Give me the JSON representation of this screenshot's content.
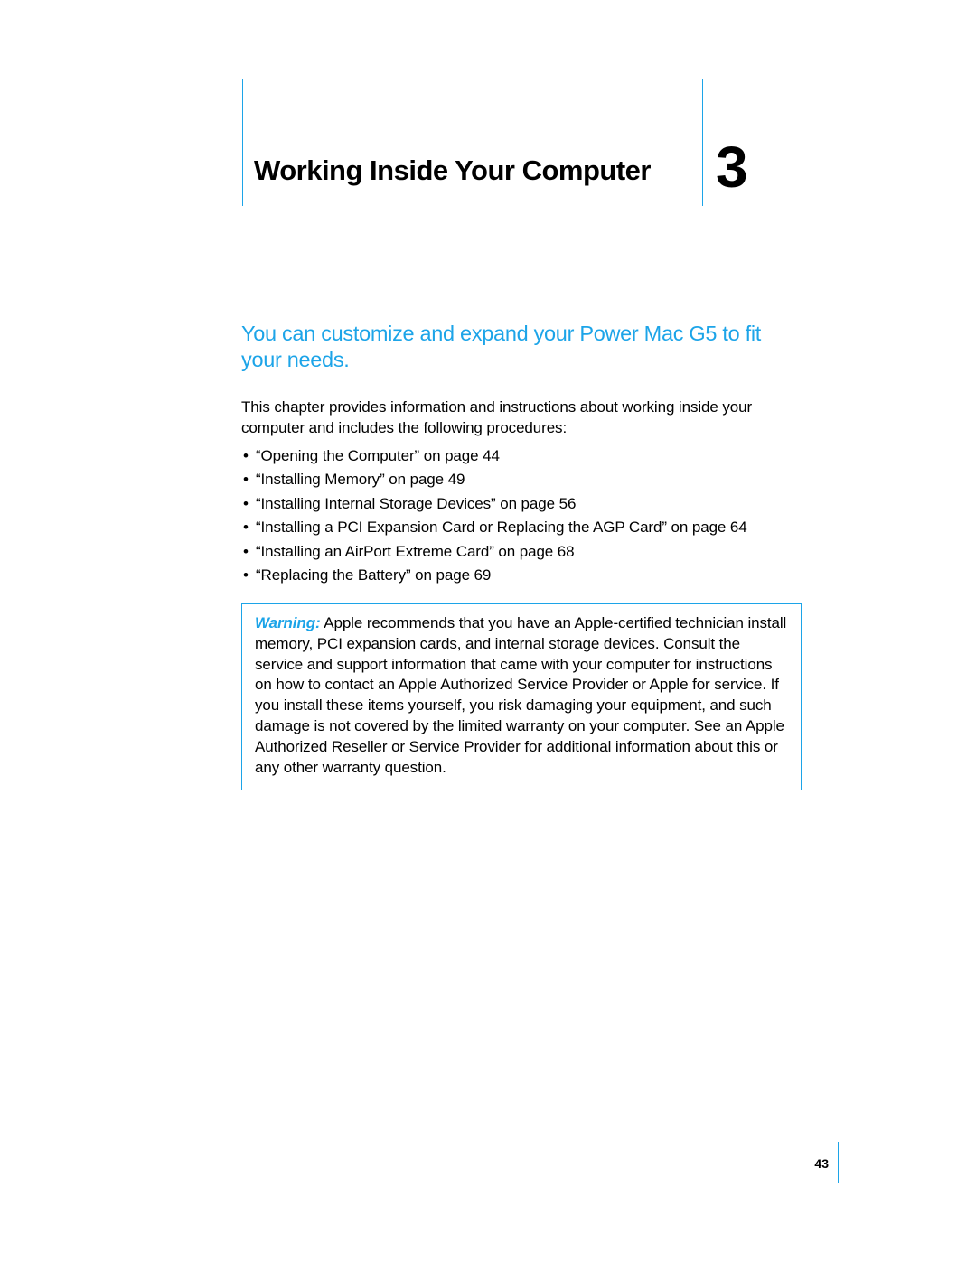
{
  "chapter": {
    "number": "3",
    "title": "Working Inside Your Computer"
  },
  "intro": "You can customize and expand your Power Mac G5 to fit your needs.",
  "body_paragraph": "This chapter provides information and instructions about working inside your computer and includes the following procedures:",
  "bullets": [
    "“Opening the Computer” on page 44",
    "“Installing Memory” on page 49",
    "“Installing Internal Storage Devices” on page 56",
    "“Installing a PCI Expansion Card or Replacing the AGP Card” on page 64",
    "“Installing an AirPort Extreme Card” on page 68",
    "“Replacing the Battery” on page 69"
  ],
  "warning": {
    "label": "Warning:",
    "text": "  Apple recommends that you have an Apple-certified technician install memory, PCI expansion cards, and internal storage devices. Consult the service and support information that came with your computer for instructions on how to contact an Apple Authorized Service Provider or Apple for service. If you install these items yourself, you risk damaging your equipment, and such damage is not covered by the limited warranty on your computer. See an Apple Authorized Reseller or Service Provider for additional information about this or any other warranty question."
  },
  "page_number": "43"
}
